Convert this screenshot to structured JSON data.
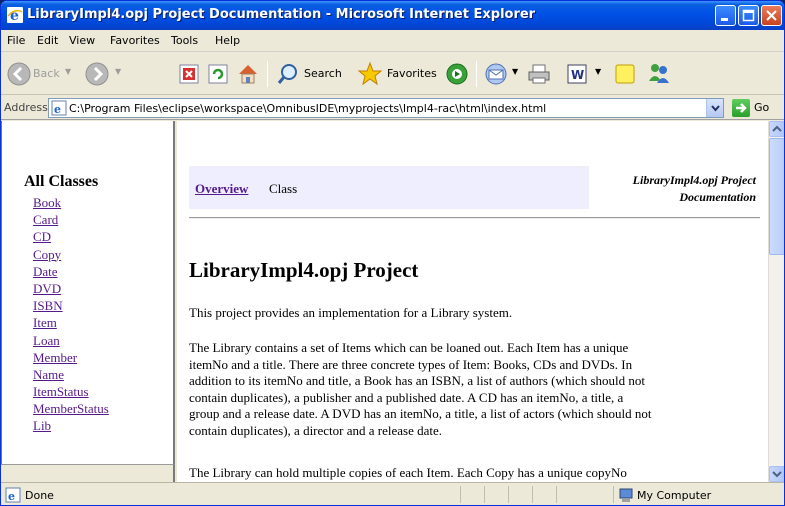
{
  "window": {
    "title": "LibraryImpl4.opj Project Documentation - Microsoft Internet Explorer"
  },
  "menu": {
    "items": [
      {
        "label": "File"
      },
      {
        "label": "Edit"
      },
      {
        "label": "View"
      },
      {
        "label": "Favorites"
      },
      {
        "label": "Tools"
      },
      {
        "label": "Help"
      }
    ]
  },
  "toolbar": {
    "back_label": "Back",
    "search_label": "Search",
    "favorites_label": "Favorites"
  },
  "address": {
    "label": "Address",
    "url": "C:\\Program Files\\eclipse\\workspace\\OmnibusIDE\\myprojects\\Impl4-rac\\html\\index.html",
    "go_label": "Go"
  },
  "left_frame": {
    "title": "All Classes",
    "classes": [
      "Book",
      "Card",
      "CD",
      "Copy",
      "Date",
      "DVD",
      "ISBN",
      "Item",
      "Loan",
      "Member",
      "Name",
      "ItemStatus",
      "MemberStatus",
      "Lib"
    ]
  },
  "main_frame": {
    "nav_overview": "Overview",
    "nav_class": "Class",
    "nav_right_line1": "LibraryImpl4.opj Project",
    "nav_right_line2": "Documentation",
    "heading": "LibraryImpl4.opj Project",
    "paragraph1": "This project provides an implementation for a Library system.",
    "paragraph2_lines": [
      "The Library contains a set of Items which can be loaned out. Each Item has a unique",
      "itemNo and a title. There are three concrete types of Item: Books, CDs and DVDs. In",
      "addition to its itemNo and title, a Book has an ISBN, a list of authors (which should not",
      "contain duplicates), a publisher and a published date. A CD has an itemNo, a title, a",
      "group and a release date. A DVD has an itemNo, a title, a list of actors (which should not",
      "contain duplicates), a director and a release date."
    ],
    "paragraph3": "The Library can hold multiple copies of each Item. Each Copy has a unique copyNo"
  },
  "status": {
    "text": "Done",
    "zone": "My Computer"
  },
  "colors": {
    "titlebar": "#0050e6",
    "link_visited": "#551a8b",
    "navbar_bg": "#eeeeff"
  }
}
